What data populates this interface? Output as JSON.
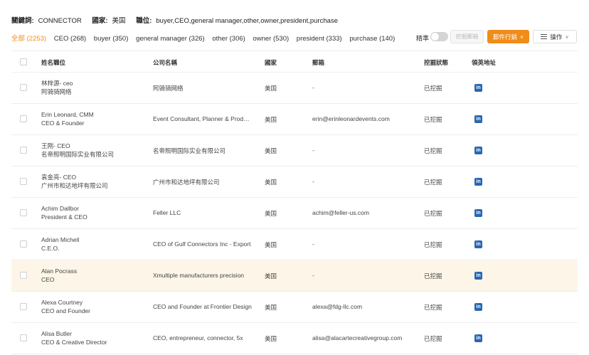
{
  "criteria": {
    "keyword_label": "關鍵詞:",
    "keyword_value": "CONNECTOR",
    "country_label": "國家:",
    "country_value": "美国",
    "position_label": "職位:",
    "position_value": "buyer,CEO,general manager,other,owner,president,purchase"
  },
  "filters": [
    {
      "label": "全部 (2253)",
      "active": true
    },
    {
      "label": "CEO (268)",
      "active": false
    },
    {
      "label": "buyer (350)",
      "active": false
    },
    {
      "label": "general manager (326)",
      "active": false
    },
    {
      "label": "other (306)",
      "active": false
    },
    {
      "label": "owner (530)",
      "active": false
    },
    {
      "label": "president (333)",
      "active": false
    },
    {
      "label": "purchase (140)",
      "active": false
    }
  ],
  "toolbar": {
    "precise_label": "精準",
    "dig_email_label": "挖掘郵箱",
    "email_marketing_label": "郵件行銷",
    "operation_label": "操作"
  },
  "columns": {
    "name": "姓名職位",
    "company": "公司名稱",
    "country": "國家",
    "email": "郵箱",
    "status": "挖掘狀態",
    "linkedin": "領英地址"
  },
  "rows": [
    {
      "name": "林梓源- ceo",
      "title": "阿骑骑网络",
      "company": "阿骑骑网络",
      "country": "美国",
      "email": "-",
      "status": "已挖掘",
      "highlight": false
    },
    {
      "name": "Erin Leonard, CMM",
      "title": "CEO & Founder",
      "company": "Event Consultant, Planner & Producer",
      "country": "美国",
      "email": "erin@erinleonardevents.com",
      "status": "已挖掘",
      "highlight": false
    },
    {
      "name": "王刚- CEO",
      "title": "名帝照明国际实业有限公司",
      "company": "名帝照明国际实业有限公司",
      "country": "美国",
      "email": "-",
      "status": "已挖掘",
      "highlight": false
    },
    {
      "name": "袁金亮- CEO",
      "title": "广州市和达地坪有限公司",
      "company": "广州市和达地坪有限公司",
      "country": "美国",
      "email": "-",
      "status": "已挖掘",
      "highlight": false
    },
    {
      "name": "Achim Dallbor",
      "title": "President & CEO",
      "company": "Feller LLC",
      "country": "美国",
      "email": "achim@feller-us.com",
      "status": "已挖掘",
      "highlight": false
    },
    {
      "name": "Adrian Michell",
      "title": "C.E.O.",
      "company": "CEO of Gulf Connectors Inc - Export",
      "country": "美国",
      "email": "-",
      "status": "已挖掘",
      "highlight": false
    },
    {
      "name": "Alan Pocrass",
      "title": "CEO",
      "company": "Xmultiple manufacturers precision",
      "country": "美国",
      "email": "-",
      "status": "已挖掘",
      "highlight": true
    },
    {
      "name": "Alexa Courtney",
      "title": "CEO and Founder",
      "company": "CEO and Founder at Frontier Design",
      "country": "美国",
      "email": "alexa@fdg-llc.com",
      "status": "已挖掘",
      "highlight": false
    },
    {
      "name": "Alisa Butler",
      "title": "CEO & Creative Director",
      "company": "CEO, entrepreneur, connector, 5x",
      "country": "美国",
      "email": "alisa@alacartecreativegroup.com",
      "status": "已挖掘",
      "highlight": false
    }
  ],
  "icons": {
    "linkedin": "linkedin-icon",
    "toggle": "toggle-switch",
    "list": "list-icon",
    "chevron": "chevron-down-icon"
  },
  "colors": {
    "accent": "#f08c1a",
    "linkedin": "#2867b2",
    "highlight_row": "#fdf6e8"
  }
}
